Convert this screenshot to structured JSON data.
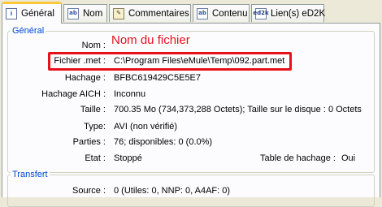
{
  "tabs": [
    {
      "label": "Général",
      "icon": "info-icon"
    },
    {
      "label": "Nom",
      "icon": "document-icon"
    },
    {
      "label": "Commentaires",
      "icon": "comment-pen-icon"
    },
    {
      "label": "Contenu",
      "icon": "document-icon"
    },
    {
      "label": "Lien(s) eD2K",
      "icon": "ed2k-link-icon",
      "icon_text": "ed2k"
    }
  ],
  "general": {
    "legend": "Général",
    "annotation": "Nom du fichier",
    "nom_label": "Nom :",
    "fichier_met_label": "Fichier .met :",
    "fichier_met_value": "C:\\Program Files\\eMule\\Temp\\092.part.met",
    "hachage_label": "Hachage :",
    "hachage_value": "BFBC619429C5E5E7",
    "hachage_aich_label": "Hachage AICH :",
    "hachage_aich_value": "Inconnu",
    "taille_label": "Taille :",
    "taille_value": "700.35 Mo  (734,373,288 Octets);  Taille sur le disque :  0 Octets",
    "type_label": "Type:",
    "type_value": "AVI  (non vérifié)",
    "parties_label": "Parties :",
    "parties_value": "76;  disponibles: 0 (0.0%)",
    "etat_label": "Etat :",
    "etat_value": "Stoppé",
    "table_hachage_label": "Table de hachage :",
    "table_hachage_value": "Oui"
  },
  "transfert": {
    "legend": "Transfert",
    "source_label": "Source :",
    "source_value": "0  (Utiles: 0, NNP: 0, A4AF: 0)"
  },
  "colors": {
    "highlight": "#e8101a",
    "legend": "#0046d5",
    "active_tab_accent": "#ffc83c"
  }
}
